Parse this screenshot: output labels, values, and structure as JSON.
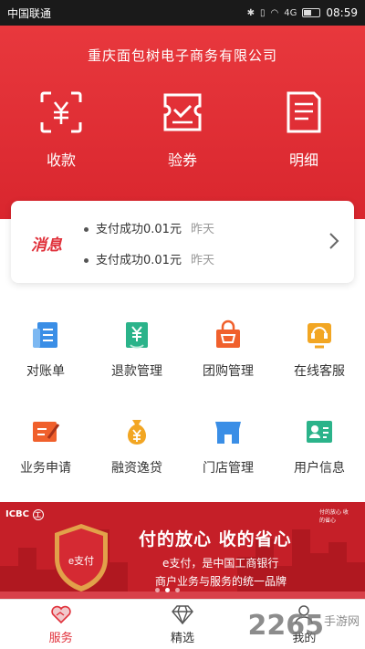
{
  "status_bar": {
    "carrier": "中国联通",
    "time": "08:59",
    "signal_label": "4G"
  },
  "header": {
    "company": "重庆面包树电子商务有限公司",
    "actions": [
      {
        "label": "收款",
        "icon": "scan-yuan-icon"
      },
      {
        "label": "验券",
        "icon": "ticket-check-icon"
      },
      {
        "label": "明细",
        "icon": "document-list-icon"
      }
    ]
  },
  "messages": {
    "logo": "消息",
    "items": [
      {
        "text": "支付成功0.01元",
        "when": "昨天"
      },
      {
        "text": "支付成功0.01元",
        "when": "昨天"
      }
    ]
  },
  "grid": [
    {
      "label": "对账单",
      "icon": "statement-icon",
      "color": "#3a8ee6"
    },
    {
      "label": "退款管理",
      "icon": "refund-icon",
      "color": "#2bb38a"
    },
    {
      "label": "团购管理",
      "icon": "shopping-bag-icon",
      "color": "#f0602c"
    },
    {
      "label": "在线客服",
      "icon": "headset-icon",
      "color": "#f2a623"
    },
    {
      "label": "业务申请",
      "icon": "application-icon",
      "color": "#f0602c"
    },
    {
      "label": "融资逸贷",
      "icon": "money-bag-icon",
      "color": "#f2a623"
    },
    {
      "label": "门店管理",
      "icon": "store-icon",
      "color": "#3a8ee6"
    },
    {
      "label": "用户信息",
      "icon": "id-card-icon",
      "color": "#2bb38a"
    }
  ],
  "banner": {
    "bank": "ICBC",
    "bank_mark": "工",
    "title": "付的放心  收的省心",
    "sub1": "e支付，是中国工商银行",
    "sub2": "商户业务与服务的统一品牌",
    "shield_text": "e支付",
    "seal_text": "付的放心 收的省心"
  },
  "tabs": [
    {
      "label": "服务",
      "icon": "heart-handshake-icon",
      "active": true
    },
    {
      "label": "精选",
      "icon": "diamond-icon",
      "active": false
    },
    {
      "label": "我的",
      "icon": "user-icon",
      "active": false
    }
  ],
  "watermark": {
    "number": "2265",
    "suffix": "手游网"
  },
  "colors": {
    "brand_red": "#e0303a",
    "header_red": "#d9262e"
  }
}
